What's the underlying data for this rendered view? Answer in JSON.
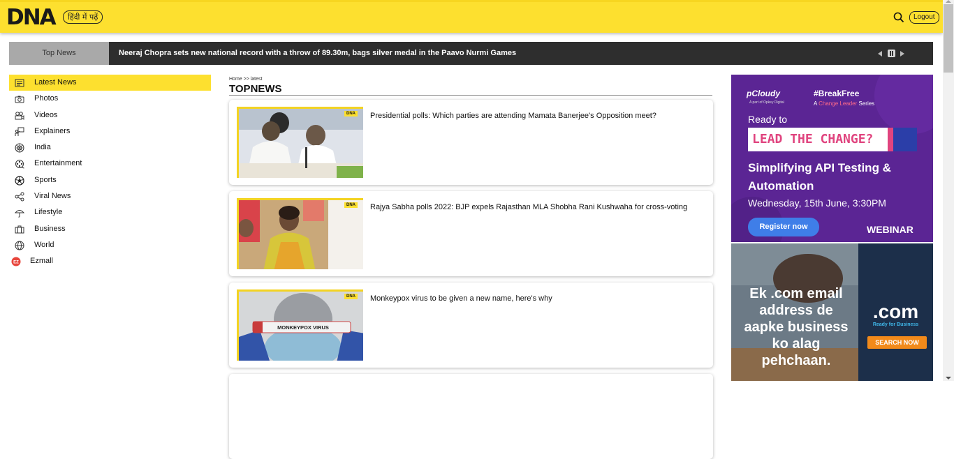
{
  "header": {
    "logo": "DNA",
    "language_button": "हिंदी में पढ़ें",
    "logout_label": "Logout",
    "background_color": "#fde02f"
  },
  "ticker": {
    "label": "Top News",
    "headline": "Neeraj Chopra sets new national record with a throw of 89.30m, bags silver medal in the Paavo Nurmi Games"
  },
  "sidebar": {
    "items": [
      {
        "label": "Latest News",
        "icon": "newspaper-icon",
        "active": true
      },
      {
        "label": "Photos",
        "icon": "camera-icon"
      },
      {
        "label": "Videos",
        "icon": "video-camera-icon"
      },
      {
        "label": "Explainers",
        "icon": "presenter-icon"
      },
      {
        "label": "India",
        "icon": "ashoka-chakra-icon"
      },
      {
        "label": "Entertainment",
        "icon": "film-reel-icon"
      },
      {
        "label": "Sports",
        "icon": "football-icon"
      },
      {
        "label": "Viral News",
        "icon": "share-icon"
      },
      {
        "label": "Lifestyle",
        "icon": "umbrella-icon"
      },
      {
        "label": "Business",
        "icon": "briefcase-icon"
      },
      {
        "label": "World",
        "icon": "globe-icon"
      },
      {
        "label": "Ezmall",
        "icon": "ezmall-logo-icon"
      }
    ]
  },
  "main": {
    "breadcrumb": "Home >> latest",
    "section_title": "TOPNEWS",
    "articles": [
      {
        "title": "Presidential polls: Which parties are attending Mamata Banerjee's Opposition meet?",
        "tag": "DNA"
      },
      {
        "title": "Rajya Sabha polls 2022: BJP expels Rajasthan MLA Shobha Rani Kushwaha for cross-voting",
        "tag": "DNA"
      },
      {
        "title": "Monkeypox virus to be given a new name, here's why",
        "tag": "DNA",
        "overlay_text": "MONKEYPOX VIRUS"
      }
    ]
  },
  "ads": {
    "pcloudy": {
      "brand": "pCloudy",
      "brand_sub": "A part of Opkey Digital",
      "hashtag": "#BreakFree",
      "tagline_pre": "A ",
      "tagline_highlight": "Change Leader",
      "tagline_post": " Series",
      "ready": "Ready to",
      "lead": "LEAD THE CHANGE?",
      "headline": "Simplifying API Testing & Automation",
      "date": "Wednesday, 15th June, 3:30PM",
      "cta": "Register now",
      "webinar": "WEBINAR"
    },
    "dotcom": {
      "lines": [
        "Ek .com email",
        "address de",
        "aapke business",
        "ko alag",
        "pehchaan."
      ],
      "brand": ".com",
      "brand_sub": "Ready for Business",
      "cta": "SEARCH NOW"
    }
  }
}
